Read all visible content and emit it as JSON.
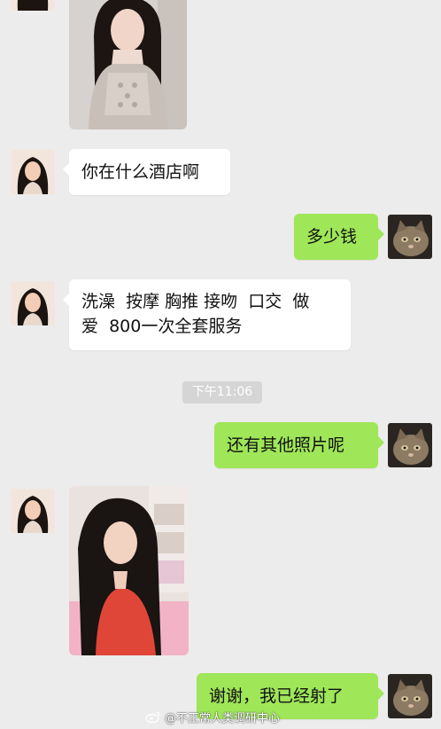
{
  "chat": {
    "time": "下午11:06",
    "messages": [
      {
        "side": "left",
        "text": "你在什么酒店啊"
      },
      {
        "side": "right",
        "text": "多少钱"
      },
      {
        "side": "left",
        "line1": "洗澡  按摩 胸推 接吻  口交  做",
        "line2": "爱  800一次全套服务"
      },
      {
        "side": "right",
        "text": "还有其他照片呢"
      },
      {
        "side": "right",
        "text": "谢谢，我已经射了"
      }
    ]
  },
  "watermark": {
    "text": "@不正常人类调研中心"
  },
  "icons": {
    "left_avatar": "girl-avatar-icon",
    "right_avatar": "cat-avatar-icon",
    "watermark_logo": "weibo-logo-icon"
  }
}
